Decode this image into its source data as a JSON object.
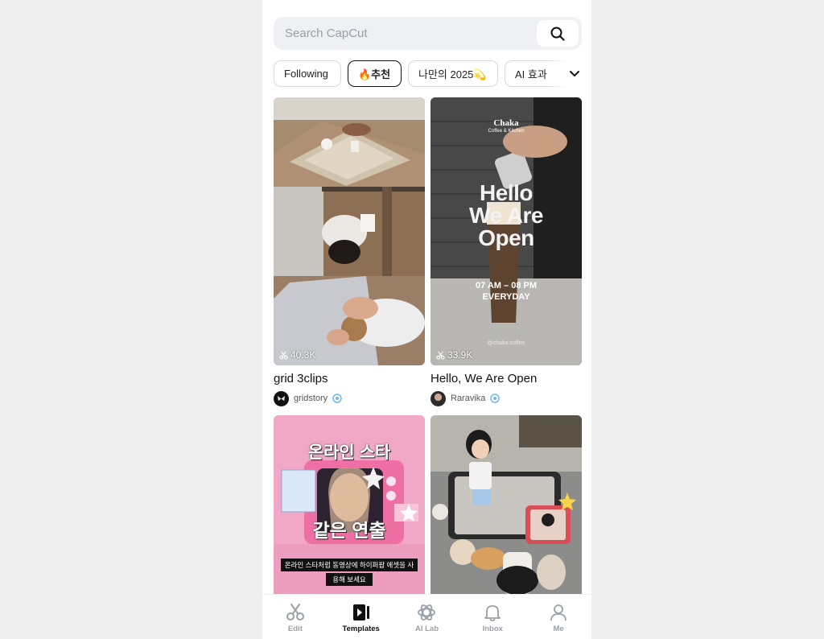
{
  "search": {
    "placeholder": "Search CapCut"
  },
  "tabs": [
    {
      "label": "Following"
    },
    {
      "label": "🔥추천"
    },
    {
      "label": "나만의 2025💫"
    },
    {
      "label": "AI 효과"
    }
  ],
  "cards": [
    {
      "title": "grid 3clips",
      "uses": "40.3K",
      "author": "gridstory"
    },
    {
      "title": "Hello, We Are Open",
      "uses": "33.9K",
      "author": "Raravika",
      "overlay": {
        "brand": "Chaka",
        "brand_sub": "Coffee & Kitchen",
        "headline1": "Hello",
        "headline2": "We Are",
        "headline3": "Open",
        "hours": "07 AM – 08 PM",
        "days": "EVERYDAY",
        "handle": "@chaka.coffee"
      }
    },
    {
      "overlay": {
        "top": "온라인 스타",
        "mid": "같은 연출",
        "caption1": "온라인 스타처럼 동영상에 하이퍼팝 에셋을 사",
        "caption2": "용해 보세요"
      }
    },
    {}
  ],
  "nav": [
    {
      "label": "Edit",
      "icon": "scissors-icon"
    },
    {
      "label": "Templates",
      "icon": "templates-icon"
    },
    {
      "label": "AI Lab",
      "icon": "atom-icon"
    },
    {
      "label": "Inbox",
      "icon": "bell-icon"
    },
    {
      "label": "Me",
      "icon": "person-icon"
    }
  ],
  "colors": {
    "accent": "#111111",
    "search_bg": "#eef0f3",
    "verified": "#6fb8e8"
  }
}
